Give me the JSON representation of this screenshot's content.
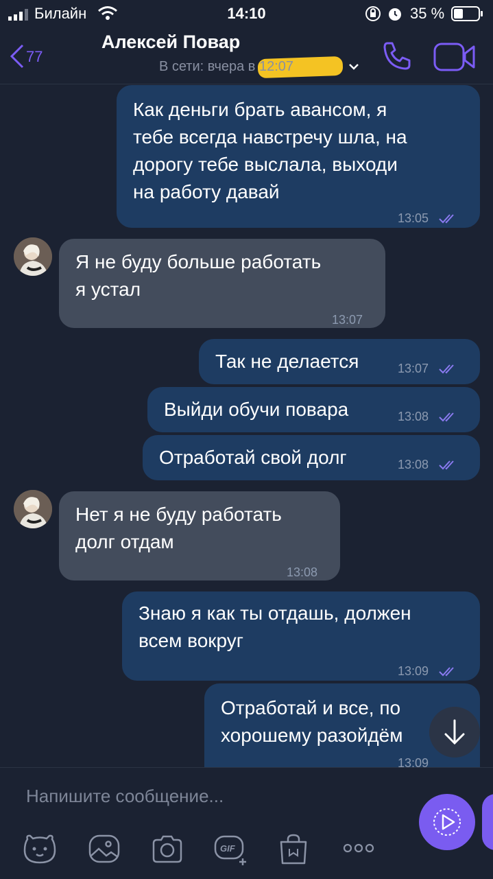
{
  "status_bar": {
    "carrier": "Билайн",
    "time": "14:10",
    "battery": "35 %"
  },
  "header": {
    "back_count": "77",
    "contact_name": "Алексей Повар",
    "online_status": "В сети: вчера в 12:07"
  },
  "messages": [
    {
      "direction": "out",
      "text": "Как деньги брать авансом, я\nтебе всегда навстречу шла, на\nдорогу тебе выслала, выходи\nна работу давай",
      "time": "13:05",
      "read": true
    },
    {
      "direction": "in",
      "text": "Я не буду больше работать\nя устал",
      "time": "13:07"
    },
    {
      "direction": "out",
      "text": "Так не делается",
      "time": "13:07",
      "read": true
    },
    {
      "direction": "out",
      "text": "Выйди обучи повара",
      "time": "13:08",
      "read": true
    },
    {
      "direction": "out",
      "text": "Отработай свой долг",
      "time": "13:08",
      "read": true
    },
    {
      "direction": "in",
      "text": "Нет я не буду работать\nдолг отдам",
      "time": "13:08"
    },
    {
      "direction": "out",
      "text": "Знаю я как ты отдашь, должен\nвсем вокруг",
      "time": "13:09",
      "read": true
    },
    {
      "direction": "out",
      "text": "Отработай и все, по\nхорошему разойдём",
      "time": "13:09",
      "read": true
    }
  ],
  "composer": {
    "placeholder": "Напишите сообщение..."
  },
  "colors": {
    "background": "#1b2232",
    "outgoing_bubble": "#1e3c62",
    "incoming_bubble": "#434c5c",
    "accent": "#7b5cf5"
  },
  "toolbar_icons": [
    "sticker-icon",
    "gallery-icon",
    "camera-icon",
    "gif-icon",
    "shopping-bag-icon",
    "more-icon"
  ]
}
